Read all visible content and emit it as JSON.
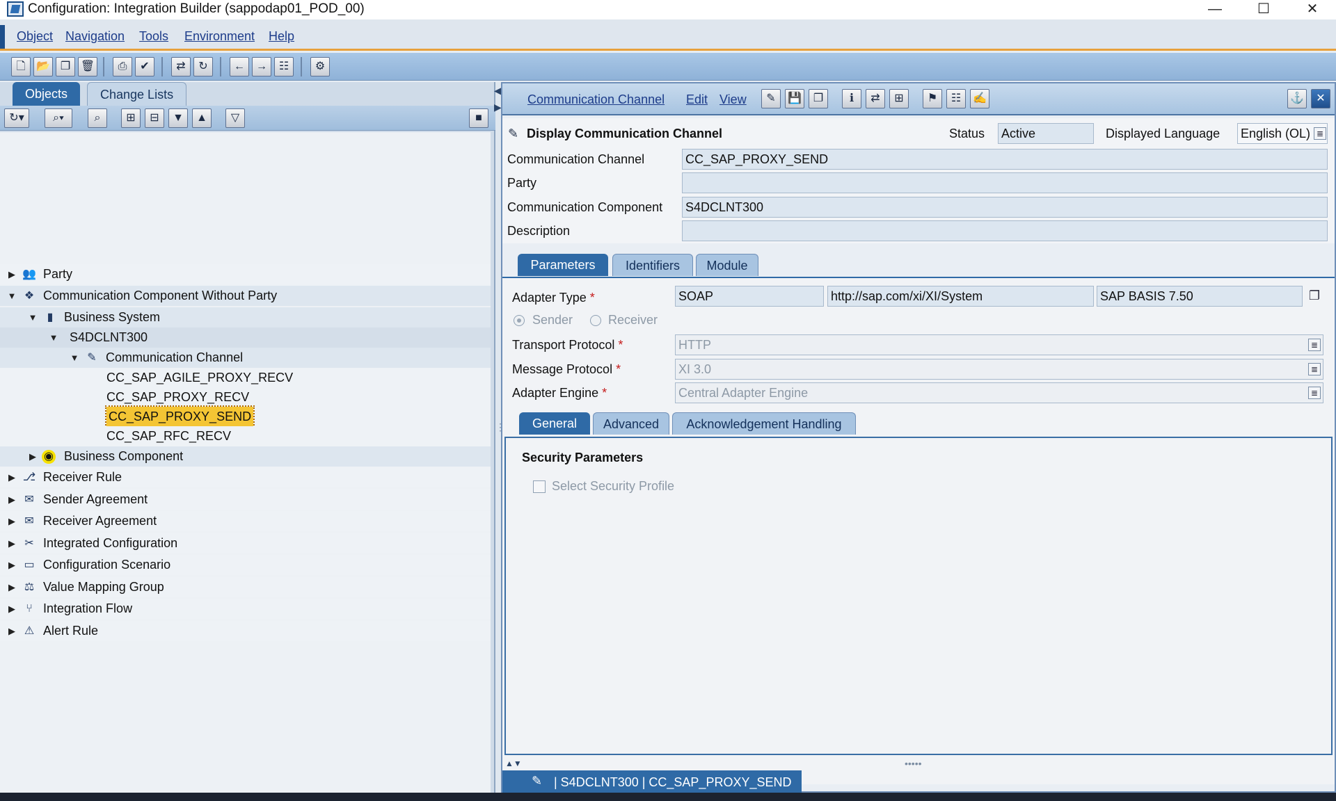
{
  "window": {
    "title": "Configuration: Integration Builder (sappodap01_POD_00)"
  },
  "menubar": {
    "items": [
      "Object",
      "Navigation",
      "Tools",
      "Environment",
      "Help"
    ]
  },
  "left_tabs": [
    "Objects",
    "Change Lists"
  ],
  "tree": [
    {
      "label": "Party",
      "level": 0,
      "toggle": "right",
      "icon": "party-icon"
    },
    {
      "label": "Communication Component Without Party",
      "level": 0,
      "toggle": "down",
      "icon": "component-icon"
    },
    {
      "label": "Business System",
      "level": 1,
      "toggle": "down",
      "icon": "business-system-icon"
    },
    {
      "label": "S4DCLNT300",
      "level": 2,
      "toggle": "down",
      "icon": ""
    },
    {
      "label": "Communication Channel",
      "level": 3,
      "toggle": "down",
      "icon": "channel-icon"
    },
    {
      "label": "CC_SAP_AGILE_PROXY_RECV",
      "level": 4,
      "toggle": "",
      "icon": ""
    },
    {
      "label": "CC_SAP_PROXY_RECV",
      "level": 4,
      "toggle": "",
      "icon": ""
    },
    {
      "label": "CC_SAP_PROXY_SEND",
      "level": 4,
      "toggle": "",
      "icon": "",
      "selected": true
    },
    {
      "label": "CC_SAP_RFC_RECV",
      "level": 4,
      "toggle": "",
      "icon": ""
    },
    {
      "label": "Business Component",
      "level": 1,
      "toggle": "right",
      "icon": "business-component-icon"
    },
    {
      "label": "Receiver Rule",
      "level": 0,
      "toggle": "right",
      "icon": "receiver-rule-icon"
    },
    {
      "label": "Sender Agreement",
      "level": 0,
      "toggle": "right",
      "icon": "sender-agreement-icon"
    },
    {
      "label": "Receiver Agreement",
      "level": 0,
      "toggle": "right",
      "icon": "receiver-agreement-icon"
    },
    {
      "label": "Integrated Configuration",
      "level": 0,
      "toggle": "right",
      "icon": "integrated-configuration-icon"
    },
    {
      "label": "Configuration Scenario",
      "level": 0,
      "toggle": "right",
      "icon": "configuration-scenario-icon"
    },
    {
      "label": "Value Mapping Group",
      "level": 0,
      "toggle": "right",
      "icon": "value-mapping-icon"
    },
    {
      "label": "Integration Flow",
      "level": 0,
      "toggle": "right",
      "icon": "integration-flow-icon"
    },
    {
      "label": "Alert Rule",
      "level": 0,
      "toggle": "right",
      "icon": "alert-rule-icon"
    }
  ],
  "right_menu": [
    "Communication Channel",
    "Edit",
    "View"
  ],
  "header": {
    "title": "Display Communication Channel",
    "status_label": "Status",
    "status_value": "Active",
    "language_label": "Displayed Language",
    "language_value": "English (OL)",
    "rows": [
      {
        "label": "Communication Channel",
        "value": "CC_SAP_PROXY_SEND"
      },
      {
        "label": "Party",
        "value": ""
      },
      {
        "label": "Communication Component",
        "value": "S4DCLNT300"
      },
      {
        "label": "Description",
        "value": ""
      }
    ]
  },
  "tabs": [
    "Parameters",
    "Identifiers",
    "Module"
  ],
  "params": {
    "adapter_type_label": "Adapter Type",
    "adapter_type": "SOAP",
    "adapter_namespace": "http://sap.com/xi/XI/System",
    "adapter_swcv": "SAP BASIS 7.50",
    "sender_label": "Sender",
    "receiver_label": "Receiver",
    "transport_protocol_label": "Transport Protocol",
    "transport_protocol": "HTTP",
    "message_protocol_label": "Message Protocol",
    "message_protocol": "XI 3.0",
    "adapter_engine_label": "Adapter Engine",
    "adapter_engine": "Central Adapter Engine",
    "required_marker": "*"
  },
  "subtabs": [
    "General",
    "Advanced",
    "Acknowledgement Handling"
  ],
  "general": {
    "section_title": "Security Parameters",
    "select_security_profile": "Select Security Profile"
  },
  "bottom_tab": "| S4DCLNT300 | CC_SAP_PROXY_SEND",
  "colors": {
    "accent": "#2f6aa6",
    "selection": "#f4c534",
    "menu_underline": "#e8a13c"
  }
}
